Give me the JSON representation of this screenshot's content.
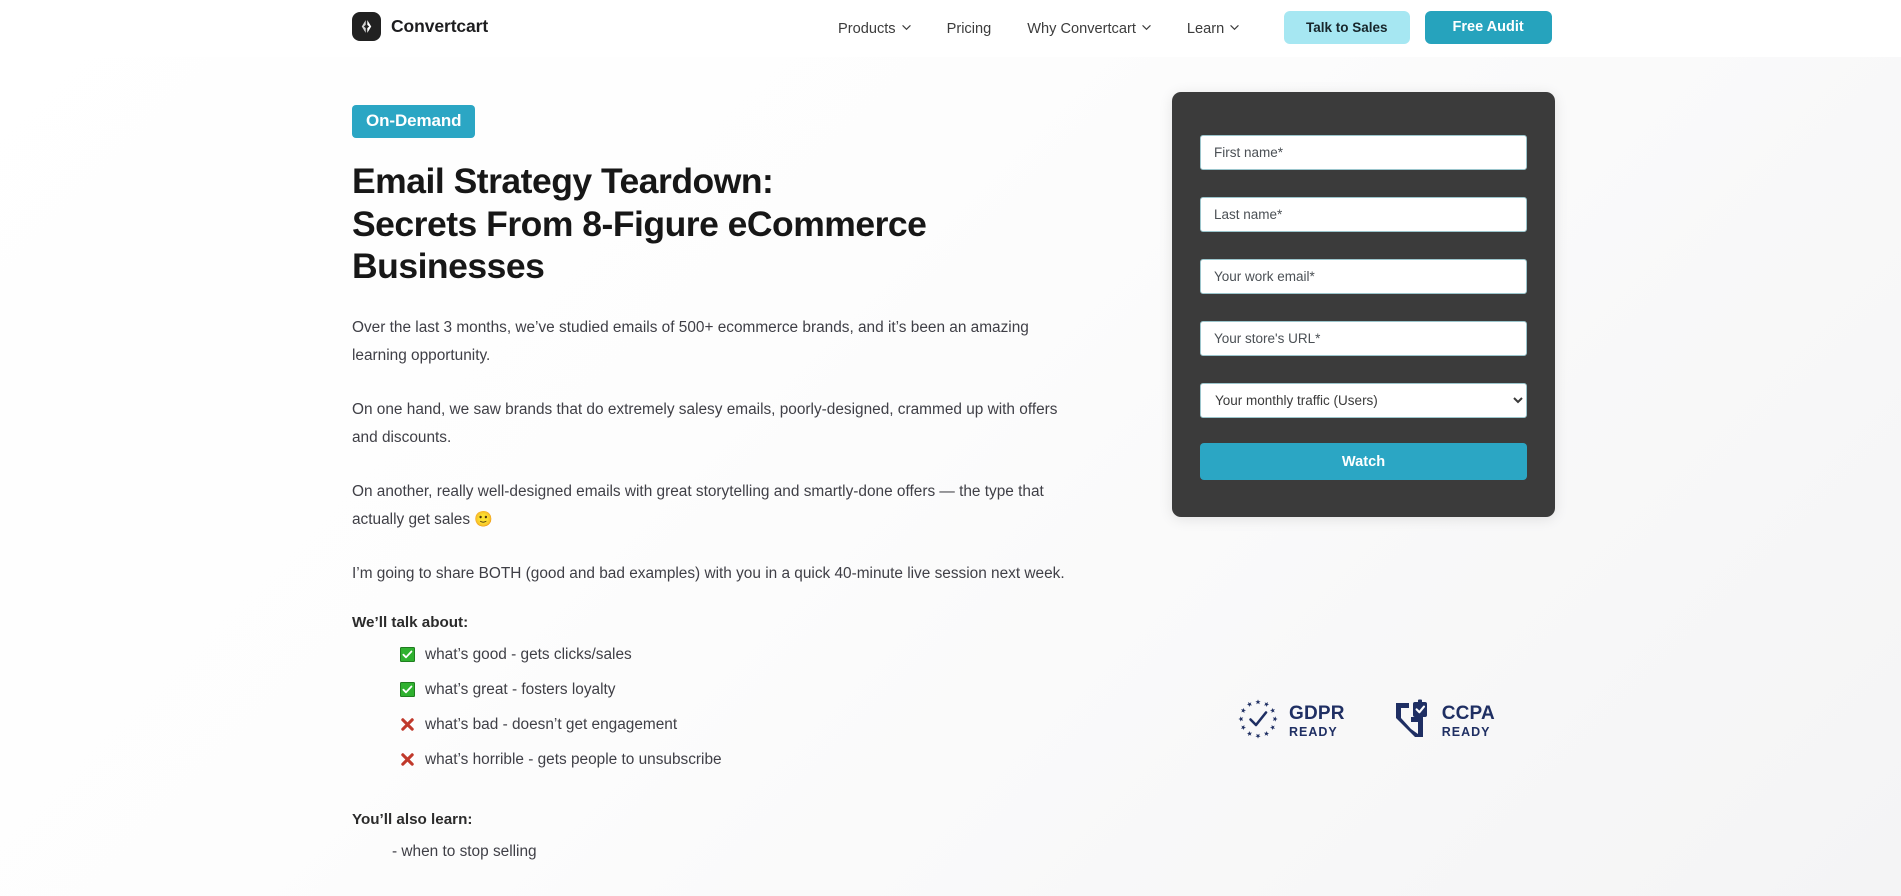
{
  "header": {
    "brand": {
      "name": "Convertcart",
      "logo_icon": "convertcart-logo-icon"
    },
    "nav": [
      {
        "label": "Products",
        "has_dropdown": true,
        "icon": "chevron-down-icon"
      },
      {
        "label": "Pricing",
        "has_dropdown": false,
        "icon": ""
      },
      {
        "label": "Why Convertcart",
        "has_dropdown": true,
        "icon": "chevron-down-icon"
      },
      {
        "label": "Learn",
        "has_dropdown": true,
        "icon": "chevron-down-icon"
      }
    ],
    "cta_secondary": "Talk to Sales",
    "cta_primary": "Free Audit"
  },
  "hero": {
    "badge": "On-Demand",
    "headline_line1": "Email Strategy Teardown:",
    "headline_line2": "Secrets From 8-Figure eCommerce",
    "headline_line3": "Businesses",
    "paragraphs": [
      "Over the last 3 months, we’ve studied emails of 500+ ecommerce brands, and it’s been an amazing learning opportunity.",
      "On one hand, we saw brands that do extremely salesy emails, poorly-designed, crammed up with offers and discounts.",
      "On another, really well-designed emails with great storytelling and smartly-done offers — the type that actually get sales",
      "I’m going to share BOTH (good and bad examples) with you in a quick 40-minute live session next week."
    ],
    "smiley_emoji": "🙂",
    "talk_about_label": "We’ll talk about:",
    "talk_about_items": [
      {
        "icon": "check-mark-button-icon",
        "text": "what’s good - gets clicks/sales"
      },
      {
        "icon": "check-mark-button-icon",
        "text": "what’s great - fosters loyalty"
      },
      {
        "icon": "cross-mark-icon",
        "text": "what’s bad - doesn’t get engagement"
      },
      {
        "icon": "cross-mark-icon",
        "text": "what’s horrible - gets people to unsubscribe"
      }
    ],
    "also_learn_label": "You’ll also learn:",
    "also_learn_items": [
      "- when to stop selling"
    ]
  },
  "form": {
    "first_name_placeholder": "First name*",
    "first_name_value": "",
    "last_name_placeholder": "Last name*",
    "last_name_value": "",
    "email_placeholder": "Your work email*",
    "email_value": "",
    "store_url_placeholder": "Your store's URL*",
    "store_url_value": "",
    "traffic_selected": "Your monthly traffic (Users)",
    "traffic_dropdown_icon": "chevron-down-icon",
    "submit_label": "Watch"
  },
  "compliance": [
    {
      "title": "GDPR",
      "subtitle": "READY",
      "icon": "gdpr-eu-stars-check-icon"
    },
    {
      "title": "CCPA",
      "subtitle": "READY",
      "icon": "ccpa-california-shield-icon"
    }
  ],
  "colors": {
    "accent_teal": "#2ba6c4",
    "accent_light_cyan": "#a6e7f2",
    "panel_dark": "#3b3b3b",
    "badge_navy": "#1f2f63",
    "check_green": "#2fb12f",
    "cross_red": "#c0392b"
  }
}
